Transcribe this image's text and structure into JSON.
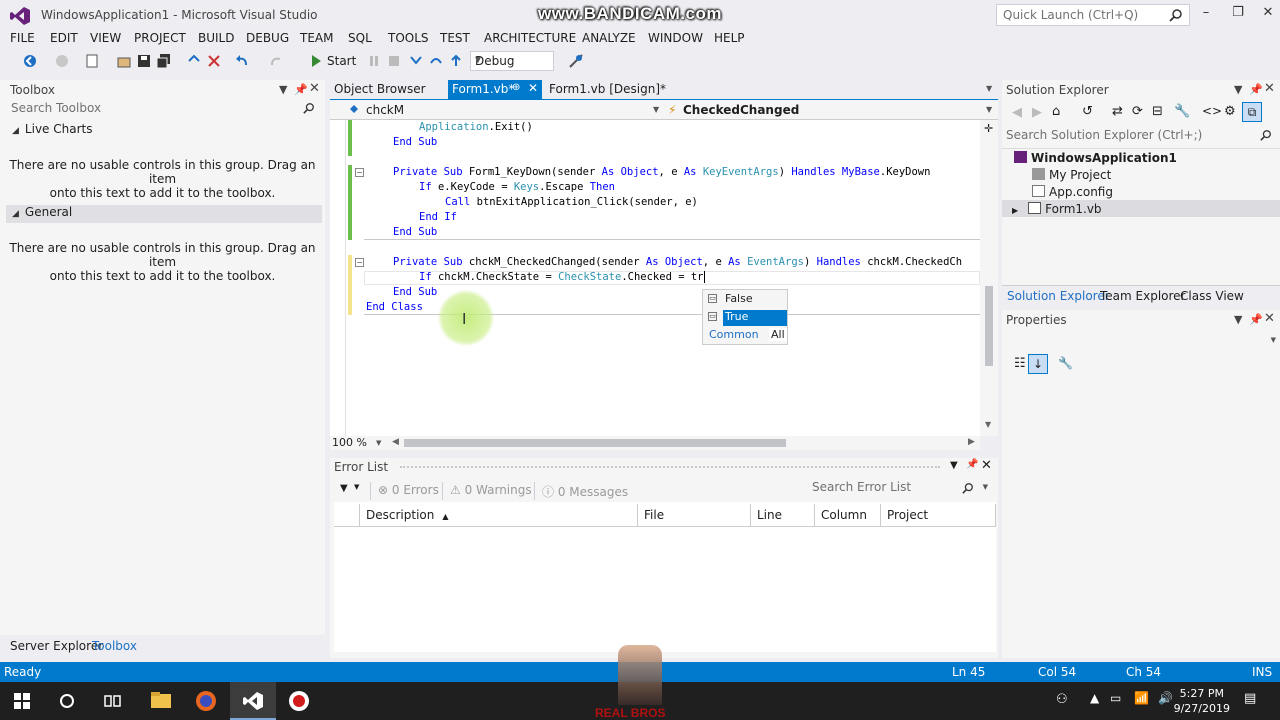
{
  "window": {
    "title": "WindowsApplication1 - Microsoft Visual Studio",
    "quick_launch_placeholder": "Quick Launch (Ctrl+Q)",
    "watermark": "www.BANDICAM.com"
  },
  "menu": [
    "FILE",
    "EDIT",
    "VIEW",
    "PROJECT",
    "BUILD",
    "DEBUG",
    "TEAM",
    "SQL",
    "TOOLS",
    "TEST",
    "ARCHITECTURE",
    "ANALYZE",
    "WINDOW",
    "HELP"
  ],
  "toolbar": {
    "start_label": "Start",
    "config": "Debug"
  },
  "toolbox": {
    "title": "Toolbox",
    "search_placeholder": "Search Toolbox",
    "group1": "Live Charts",
    "group2": "General",
    "empty_msg_line1": "There are no usable controls in this group. Drag an item",
    "empty_msg_line2": "onto this text to add it to the toolbox."
  },
  "doc_tabs": [
    "Object Browser",
    "Form1.vb*",
    "Form1.vb [Design]*"
  ],
  "editor_nav": {
    "left": "chckM",
    "right": "CheckedChanged"
  },
  "code": {
    "l1_a": "Application",
    "l1_b": ".Exit()",
    "l2": "End Sub",
    "l3_kw": "Private Sub",
    "l3_name": " Form1_KeyDown(sender ",
    "l3_as1": "As",
    "l3_obj": " Object",
    "l3_c": ", e ",
    "l3_as2": "As",
    "l3_t": " KeyEventArgs",
    "l3_h": ") ",
    "l3_handles": "Handles",
    "l3_mb": " MyBase",
    "l3_end": ".KeyDown",
    "l4_if": "If",
    "l4_mid": " e.KeyCode = ",
    "l4_keys": "Keys",
    "l4_esc": ".Escape ",
    "l4_then": "Then",
    "l5_call": "Call",
    "l5_rest": " btnExitApplication_Click(sender, e)",
    "l6": "End If",
    "l7": "End Sub",
    "l8_kw": "Private Sub",
    "l8_name": " chckM_CheckedChanged(sender ",
    "l8_as1": "As",
    "l8_obj": " Object",
    "l8_c": ", e ",
    "l8_as2": "As",
    "l8_t": " EventArgs",
    "l8_h": ") ",
    "l8_handles": "Handles",
    "l8_end": " chckM.CheckedCh",
    "l9_if": "If",
    "l9_mid": " chckM.CheckState = ",
    "l9_cs": "CheckState",
    "l9_end": ".Checked = tr",
    "l10": "End Sub",
    "l11": "End Class"
  },
  "intellisense": {
    "items": [
      "False",
      "True"
    ],
    "selected": "True",
    "tab_common": "Common",
    "tab_all": "All"
  },
  "zoom": "100 %",
  "error_list": {
    "title": "Error List",
    "errors": "0 Errors",
    "warnings": "0 Warnings",
    "messages": "0 Messages",
    "search_placeholder": "Search Error List",
    "columns": [
      "Description",
      "File",
      "Line",
      "Column",
      "Project"
    ]
  },
  "solution_explorer": {
    "title": "Solution Explorer",
    "search_placeholder": "Search Solution Explorer (Ctrl+;)",
    "items": [
      "WindowsApplication1",
      "My Project",
      "App.config",
      "Form1.vb"
    ],
    "tabs": [
      "Solution Explorer",
      "Team Explorer",
      "Class View"
    ]
  },
  "properties": {
    "title": "Properties"
  },
  "bottom_tabs": [
    "Server Explorer",
    "Toolbox"
  ],
  "status": {
    "left": "Ready",
    "ln": "Ln 45",
    "col": "Col 54",
    "ch": "Ch 54",
    "mode": "INS"
  },
  "taskbar": {
    "time": "5:27 PM",
    "date": "9/27/2019",
    "brand": "REAL BROS"
  },
  "colors": {
    "accent": "#007acc",
    "keyword": "#0000ff",
    "type": "#2b91af"
  }
}
